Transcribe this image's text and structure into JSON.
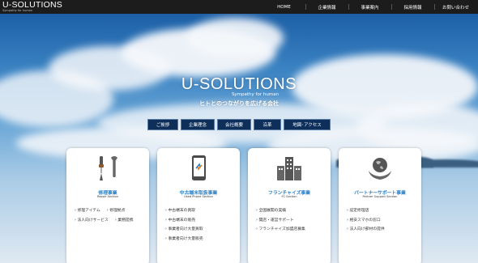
{
  "header": {
    "logo_main": "U-SOLUTIONS",
    "logo_sub": "Sympathy for human",
    "nav": [
      "HOME",
      "企業情報",
      "事業案内",
      "採用情報",
      "お問い合わせ"
    ]
  },
  "hero": {
    "title": "U-SOLUTIONS",
    "subtitle": "Sympathy for human",
    "tagline": "ヒトとのつながりを広げる会社",
    "buttons": [
      "ご挨拶",
      "企業理念",
      "会社概要",
      "沿革",
      "地図･アクセス"
    ]
  },
  "cards": [
    {
      "icon": "tools-icon",
      "title": "修理事業",
      "subtitle": "Repair Section",
      "links": [
        [
          "修理アイテム",
          "修理拠点"
        ],
        [
          "法人向けサービス",
          "業務提携"
        ]
      ]
    },
    {
      "icon": "phone-recycle-icon",
      "title": "中古端末取扱事業",
      "subtitle": "Used Phone Section",
      "links": [
        [
          "中古端末の買取"
        ],
        [
          "中古端末の販売"
        ],
        [
          "事業者向け大量買取"
        ],
        [
          "事業者向け大量販売"
        ]
      ]
    },
    {
      "icon": "buildings-icon",
      "title": "フランチャイズ事業",
      "subtitle": "FC Section",
      "links": [
        [
          "全国展開の実績"
        ],
        [
          "開店・運営サポート"
        ],
        [
          "フランチャイズ加盟店募集"
        ]
      ]
    },
    {
      "icon": "globe-hand-icon",
      "title": "パートナーサポート事業",
      "subtitle": "Partner Support Section",
      "links": [
        [
          "認定修理店"
        ],
        [
          "格安スマホの窓口"
        ],
        [
          "法人向け部材の提供"
        ]
      ]
    }
  ],
  "colors": {
    "header_bg": "#1c1c1c",
    "button_bg": "#0d2f5a",
    "accent": "#2a7fc6"
  }
}
